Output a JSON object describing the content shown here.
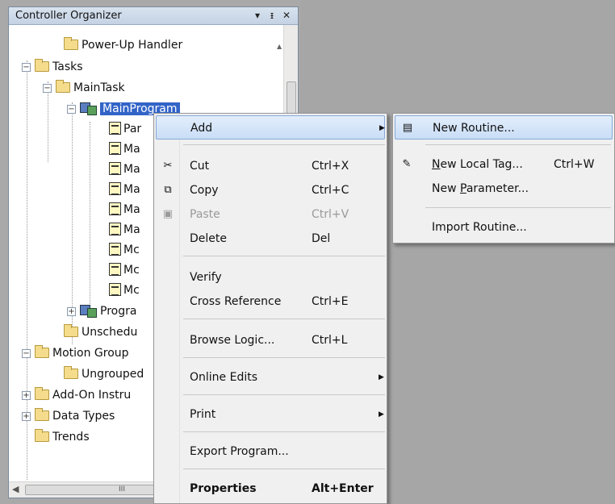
{
  "organizer": {
    "title": "Controller Organizer",
    "pin_glyph": "▾",
    "dock_glyph": "ᴾ",
    "close_glyph": "✕"
  },
  "tree": {
    "power_up_handler": "Power-Up Handler",
    "tasks": "Tasks",
    "main_task": "MainTask",
    "main_program": "MainProgram",
    "children": [
      "Par",
      "Ma",
      "Ma",
      "Ma",
      "Ma",
      "Ma",
      "Mc",
      "Mc",
      "Mc"
    ],
    "program_partial": "Progra",
    "unscheduled": "Unschedu",
    "motion_groups": "Motion Group",
    "ungrouped": "Ungrouped",
    "add_on": "Add-On Instru",
    "data_types": "Data Types",
    "trends": "Trends",
    "hscroll_label": "III",
    "expand_minus": "−",
    "expand_plus": "+"
  },
  "context_menu": {
    "items": [
      {
        "label": "Add",
        "shortcut": "",
        "has_submenu": true
      },
      {
        "label": "Cut",
        "shortcut": "Ctrl+X"
      },
      {
        "label": "Copy",
        "shortcut": "Ctrl+C"
      },
      {
        "label": "Paste",
        "shortcut": "Ctrl+V",
        "disabled": true
      },
      {
        "label": "Delete",
        "shortcut": "Del"
      },
      {
        "label": "Verify",
        "shortcut": ""
      },
      {
        "label": "Cross Reference",
        "shortcut": "Ctrl+E"
      },
      {
        "label": "Browse Logic...",
        "shortcut": "Ctrl+L"
      },
      {
        "label": "Online Edits",
        "shortcut": "",
        "has_submenu": true
      },
      {
        "label": "Print",
        "shortcut": "",
        "has_submenu": true
      },
      {
        "label": "Export Program...",
        "shortcut": ""
      },
      {
        "label": "Properties",
        "shortcut": "Alt+Enter",
        "bold": true
      }
    ],
    "arrow_glyph": "▶"
  },
  "submenu": {
    "new_routine": "New Routine...",
    "new_local_tag_prefix": "N",
    "new_local_tag_rest": "ew Local Tag...",
    "new_local_tag_shortcut": "Ctrl+W",
    "new_parameter_prefix": "New ",
    "new_parameter_ul": "P",
    "new_parameter_rest": "arameter...",
    "import_routine": "Import Routine..."
  },
  "colors": {
    "highlight": "#c9ddf6",
    "selection": "#3264c8",
    "workspace": "#a6a6a6"
  }
}
